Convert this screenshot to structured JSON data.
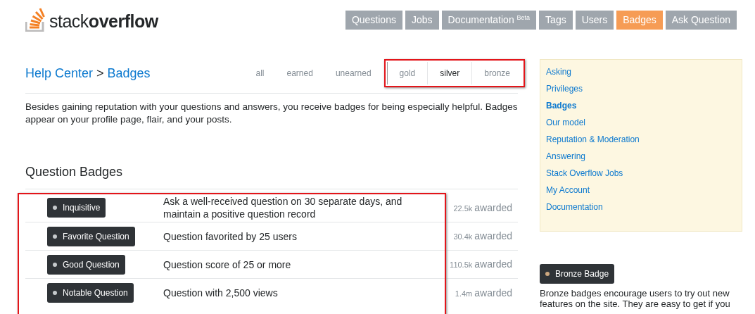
{
  "header": {
    "logo": {
      "word_1": "stack",
      "word_2": "overflow"
    },
    "nav": [
      {
        "label": "Questions",
        "selected": false
      },
      {
        "label": "Jobs",
        "selected": false
      },
      {
        "label": "Documentation $^{Beta}$",
        "selected": false
      },
      {
        "label": "Tags",
        "selected": false
      },
      {
        "label": "Users",
        "selected": false
      },
      {
        "label": "Badges",
        "selected": true
      },
      {
        "label": "Ask Question",
        "selected": false
      }
    ]
  },
  "breadcrumb": {
    "parent": "Help Center",
    "separator": ">",
    "current": "Badges"
  },
  "filters": {
    "status": [
      {
        "label": "all",
        "selected": false
      },
      {
        "label": "earned",
        "selected": false
      },
      {
        "label": "unearned",
        "selected": false
      }
    ],
    "class": [
      {
        "label": "gold",
        "selected": false
      },
      {
        "label": "silver",
        "selected": true
      },
      {
        "label": "bronze",
        "selected": false
      }
    ]
  },
  "intro": "Besides gaining reputation with your questions and answers, you receive badges for being especially helpful. Badges appear on your profile page, flair, and your posts.",
  "section_title": "Question Badges",
  "badges": [
    {
      "name": "Inquisitive",
      "color": "#c5c9cb",
      "description": "Ask a well-received question on 30 separate days, and maintain a positive question record",
      "count": "22.5k",
      "awarded": "awarded"
    },
    {
      "name": "Favorite Question",
      "color": "#c5c9cb",
      "description": "Question favorited by 25 users",
      "count": "30.4k",
      "awarded": "awarded"
    },
    {
      "name": "Good Question",
      "color": "#c5c9cb",
      "description": "Question score of 25 or more",
      "count": "110.5k",
      "awarded": "awarded"
    },
    {
      "name": "Notable Question",
      "color": "#c5c9cb",
      "description": "Question with 2,500 views",
      "count": "1.4m",
      "awarded": "awarded"
    }
  ],
  "sidebar": {
    "items": [
      {
        "label": "Asking",
        "selected": false
      },
      {
        "label": "Privileges",
        "selected": false
      },
      {
        "label": "Badges",
        "selected": true
      },
      {
        "label": "Our model",
        "selected": false
      },
      {
        "label": "Reputation & Moderation",
        "selected": false
      },
      {
        "label": "Answering",
        "selected": false
      },
      {
        "label": "Stack Overflow Jobs",
        "selected": false
      },
      {
        "label": "My Account",
        "selected": false
      },
      {
        "label": "Documentation",
        "selected": false
      }
    ],
    "badge": {
      "name": "Bronze Badge",
      "color": "#cda77f"
    },
    "badge_text": "Bronze badges encourage users to try out new features on the site. They are easy to get if you"
  }
}
